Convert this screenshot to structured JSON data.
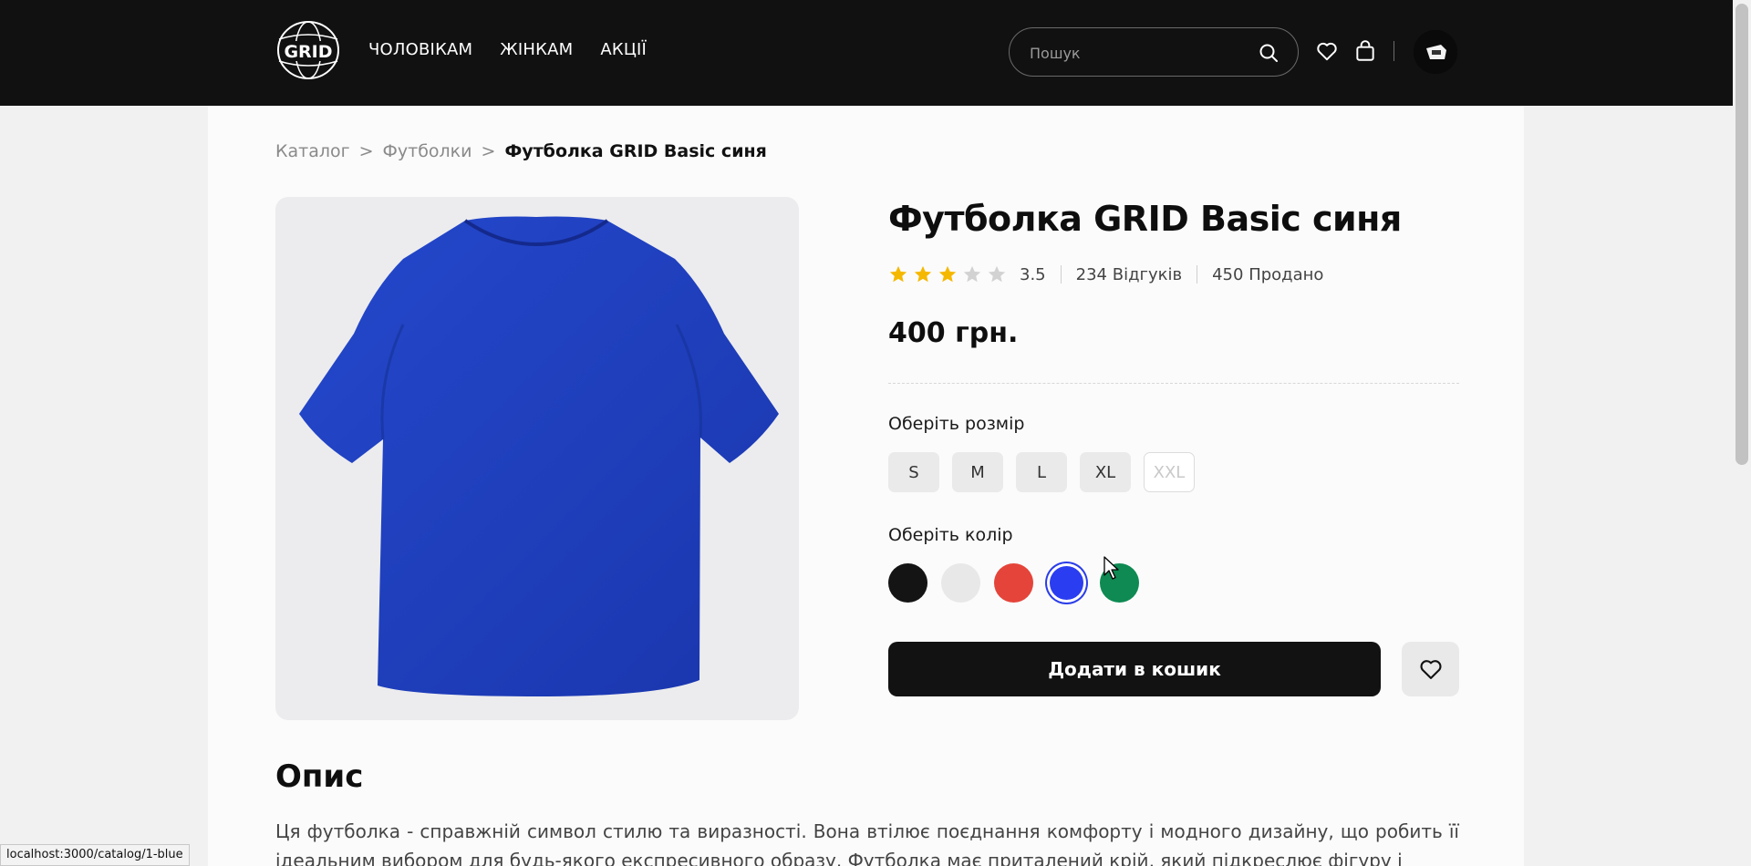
{
  "header": {
    "logo_text": "GRID",
    "nav": [
      "ЧОЛОВІКАМ",
      "ЖІНКАМ",
      "АКЦІЇ"
    ],
    "search_placeholder": "Пошук",
    "icons": [
      "search-icon",
      "heart-icon",
      "bag-icon",
      "avatar"
    ]
  },
  "breadcrumb": {
    "items": [
      "Каталог",
      "Футболки"
    ],
    "separator": ">",
    "current": "Футболка GRID Basic синя"
  },
  "product": {
    "title": "Футболка GRID Basic синя",
    "rating": "3.5",
    "rating_value": 3.5,
    "rating_max": 5,
    "reviews": "234 Відгуків",
    "sold": "450 Продано",
    "price": "400 грн.",
    "image_color": "#1f3fbf"
  },
  "size_section": {
    "label": "Оберіть розмір",
    "sizes": [
      {
        "label": "S",
        "available": true
      },
      {
        "label": "M",
        "available": true
      },
      {
        "label": "L",
        "available": true
      },
      {
        "label": "XL",
        "available": true
      },
      {
        "label": "XXL",
        "available": false
      }
    ]
  },
  "color_section": {
    "label": "Оберіть колір",
    "colors": [
      {
        "name": "black",
        "hex": "#141414",
        "selected": false
      },
      {
        "name": "white",
        "hex": "#e8e8e8",
        "selected": false
      },
      {
        "name": "red",
        "hex": "#e5443a",
        "selected": false
      },
      {
        "name": "blue",
        "hex": "#2a3df0",
        "selected": true
      },
      {
        "name": "green",
        "hex": "#0e8a52",
        "selected": false
      }
    ]
  },
  "actions": {
    "add_to_cart": "Додати в кошик"
  },
  "description": {
    "title": "Опис",
    "text": "Ця футболка - справжній символ стилю та виразності. Вона втілює поєднання комфорту і модного дизайну, що робить її ідеальним вибором для будь-якого експресивного образу. Футболка має приталений крій, який підкреслює фігуру і"
  },
  "status_url": "localhost:3000/catalog/1-blue",
  "colors": {
    "header_bg": "#111111",
    "accent_star": "#f5b800"
  }
}
